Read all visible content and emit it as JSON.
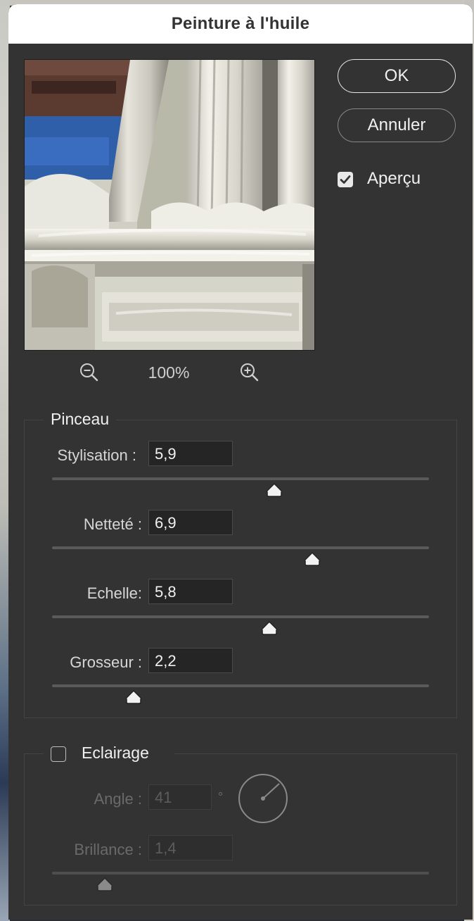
{
  "dialog": {
    "title": "Peinture à l'huile"
  },
  "buttons": {
    "ok": "OK",
    "cancel": "Annuler"
  },
  "preview_toggle": {
    "label": "Aperçu",
    "checked": true
  },
  "zoom": {
    "level": "100%",
    "zoom_out_icon": "zoom-out-icon",
    "zoom_in_icon": "zoom-in-icon"
  },
  "pinceau": {
    "title": "Pinceau",
    "params": [
      {
        "label": "Stylisation :",
        "value": "5,9",
        "fraction": 0.59
      },
      {
        "label": "Netteté :",
        "value": "6,9",
        "fraction": 0.69
      },
      {
        "label": "Echelle:",
        "value": "5,8",
        "fraction": 0.576
      },
      {
        "label": "Grosseur :",
        "value": "2,2",
        "fraction": 0.217
      }
    ]
  },
  "eclairage": {
    "title": "Eclairage",
    "checked": false,
    "angle_label": "Angle :",
    "angle_value": "41",
    "degree_symbol": "°",
    "brillance_label": "Brillance :",
    "brillance_value": "1,4",
    "brillance_fraction": 0.14
  },
  "colors": {
    "dialog_bg": "#333333",
    "titlebar_bg": "#ffffff",
    "text": "#f0f0f0",
    "disabled_text": "#6a6a6a"
  }
}
